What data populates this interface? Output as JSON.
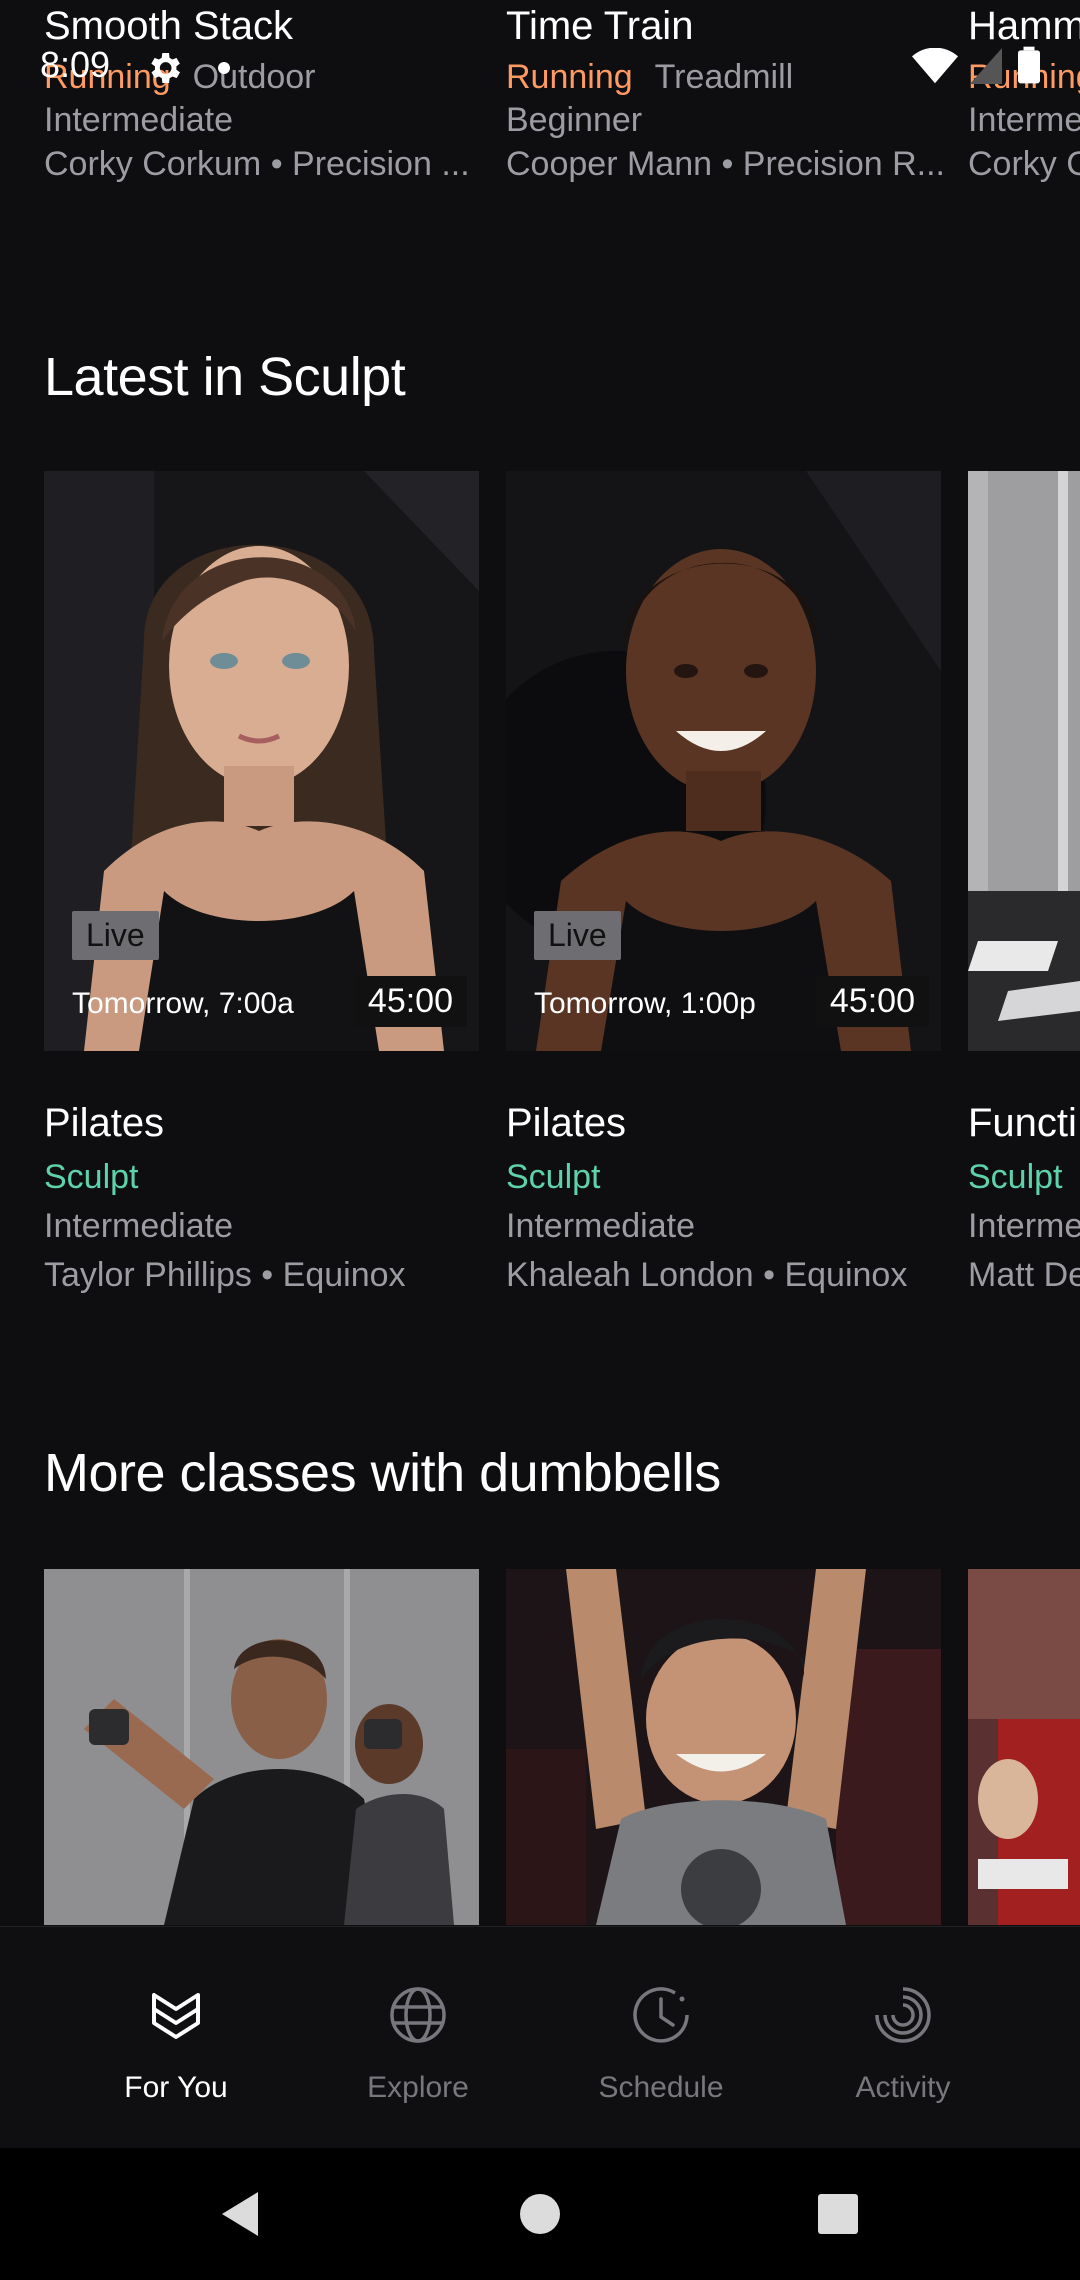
{
  "status_bar": {
    "time": "8:09"
  },
  "top_row": {
    "cards": [
      {
        "title": "Smooth Stack",
        "tag_primary": "Running",
        "tag_secondary": "Outdoor",
        "level": "Intermediate",
        "meta": "Corky Corkum • Precision ..."
      },
      {
        "title": "Time Train",
        "tag_primary": "Running",
        "tag_secondary": "Treadmill",
        "level": "Beginner",
        "meta": "Cooper Mann • Precision R..."
      },
      {
        "title": "Hamm",
        "tag_primary": "Running",
        "tag_secondary": "",
        "level": "Interme",
        "meta": "Corky C"
      }
    ]
  },
  "sculpt_section": {
    "title": "Latest in Sculpt",
    "cards": [
      {
        "badge": "Live",
        "time": "Tomorrow, 7:00a",
        "duration": "45:00",
        "title": "Pilates",
        "category": "Sculpt",
        "level": "Intermediate",
        "meta": "Taylor Phillips • Equinox"
      },
      {
        "badge": "Live",
        "time": "Tomorrow, 1:00p",
        "duration": "45:00",
        "title": "Pilates",
        "category": "Sculpt",
        "level": "Intermediate",
        "meta": "Khaleah London • Equinox"
      },
      {
        "title": "Functi",
        "category": "Sculpt",
        "level": "Interme",
        "meta": "Matt De"
      }
    ]
  },
  "dumbbell_section": {
    "title": "More classes with dumbbells"
  },
  "bottom_nav": {
    "items": [
      {
        "label": "For You",
        "icon": "for-you-icon",
        "active": true
      },
      {
        "label": "Explore",
        "icon": "globe-icon",
        "active": false
      },
      {
        "label": "Schedule",
        "icon": "clock-icon",
        "active": false
      },
      {
        "label": "Activity",
        "icon": "activity-rings-icon",
        "active": false
      }
    ]
  },
  "colors": {
    "accent_running": "#ff9a62",
    "accent_sculpt": "#5ed3a9",
    "background": "#0e0e11"
  }
}
